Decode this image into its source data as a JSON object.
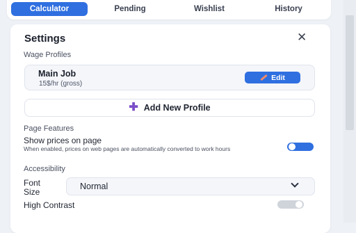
{
  "tabs": [
    {
      "label": "Calculator",
      "active": true
    },
    {
      "label": "Pending",
      "active": false
    },
    {
      "label": "Wishlist",
      "active": false
    },
    {
      "label": "History",
      "active": false
    }
  ],
  "settings": {
    "title": "Settings",
    "close_icon": "close-icon",
    "wage_profiles_heading": "Wage Profiles",
    "profile": {
      "name": "Main Job",
      "rate": "15$/hr (gross)",
      "edit_label": "Edit",
      "edit_icon": "pencil-icon"
    },
    "add_profile_label": "Add New Profile",
    "add_icon": "plus-icon",
    "page_features_heading": "Page Features",
    "show_prices": {
      "label": "Show prices on page",
      "description": "When enabled, prices on web pages are automatically converted to work hours",
      "enabled": true
    },
    "accessibility_heading": "Accessibility",
    "font_size": {
      "label": "Font Size",
      "value": "Normal"
    },
    "high_contrast": {
      "label": "High Contrast",
      "enabled": false
    }
  },
  "colors": {
    "accent": "#2f6fe0",
    "toggle_off": "#cfd4db",
    "plus": "#7b4fc9"
  }
}
